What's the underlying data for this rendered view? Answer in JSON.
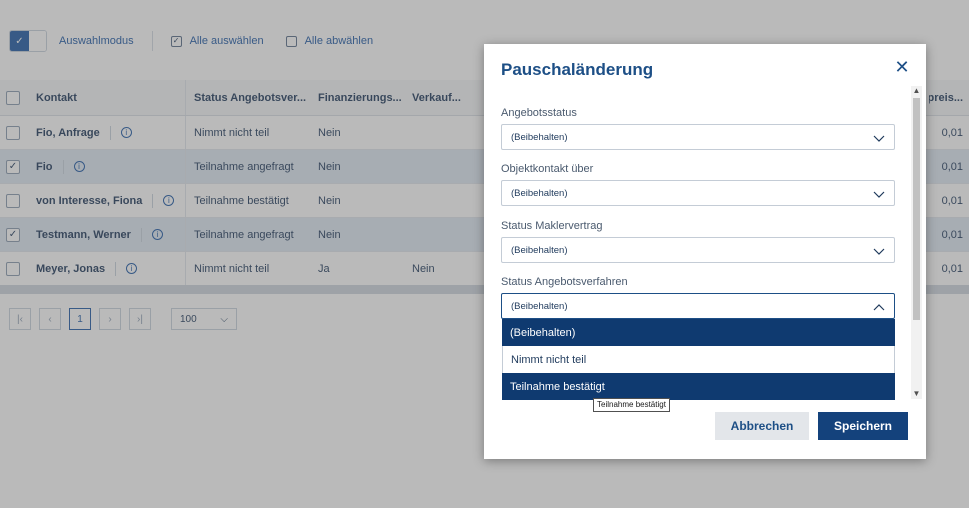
{
  "toolbar": {
    "selection_mode_label": "Auswahlmodus",
    "select_all_label": "Alle auswählen",
    "deselect_all_label": "Alle abwählen"
  },
  "table": {
    "columns": [
      "Kontakt",
      "Status Angebotsver...",
      "Finanzierungs...",
      "Verkauf...",
      "spreis..."
    ],
    "rows": [
      {
        "kontakt": "Fio, Anfrage",
        "status": "Nimmt nicht teil",
        "finanz": "Nein",
        "verkauf": "",
        "preis": "0,01",
        "selected": false
      },
      {
        "kontakt": "Fio",
        "status": "Teilnahme angefragt",
        "finanz": "Nein",
        "verkauf": "",
        "preis": "0,01",
        "selected": true
      },
      {
        "kontakt": "von Interesse, Fiona",
        "status": "Teilnahme bestätigt",
        "finanz": "Nein",
        "verkauf": "",
        "preis": "0,01",
        "selected": false
      },
      {
        "kontakt": "Testmann, Werner",
        "status": "Teilnahme angefragt",
        "finanz": "Nein",
        "verkauf": "",
        "preis": "0,01",
        "selected": true
      },
      {
        "kontakt": "Meyer, Jonas",
        "status": "Nimmt nicht teil",
        "finanz": "Ja",
        "verkauf": "Nein",
        "preis": "0,01",
        "selected": false
      }
    ]
  },
  "pager": {
    "current_page": "1",
    "page_size": "100"
  },
  "modal": {
    "title": "Pauschaländerung",
    "fields": [
      {
        "label": "Angebotsstatus",
        "value": "(Beibehalten)"
      },
      {
        "label": "Objektkontakt über",
        "value": "(Beibehalten)"
      },
      {
        "label": "Status Maklervertrag",
        "value": "(Beibehalten)"
      },
      {
        "label": "Status Angebotsverfahren",
        "value": "(Beibehalten)"
      }
    ],
    "dropdown_options": [
      "(Beibehalten)",
      "Nimmt nicht teil",
      "Teilnahme bestätigt"
    ],
    "tooltip": "Teilnahme bestätigt",
    "cancel_label": "Abbrechen",
    "save_label": "Speichern"
  },
  "colors": {
    "primary": "#1d4f86",
    "highlight": "#0f3a70",
    "selected_row": "#dfe8f3"
  }
}
